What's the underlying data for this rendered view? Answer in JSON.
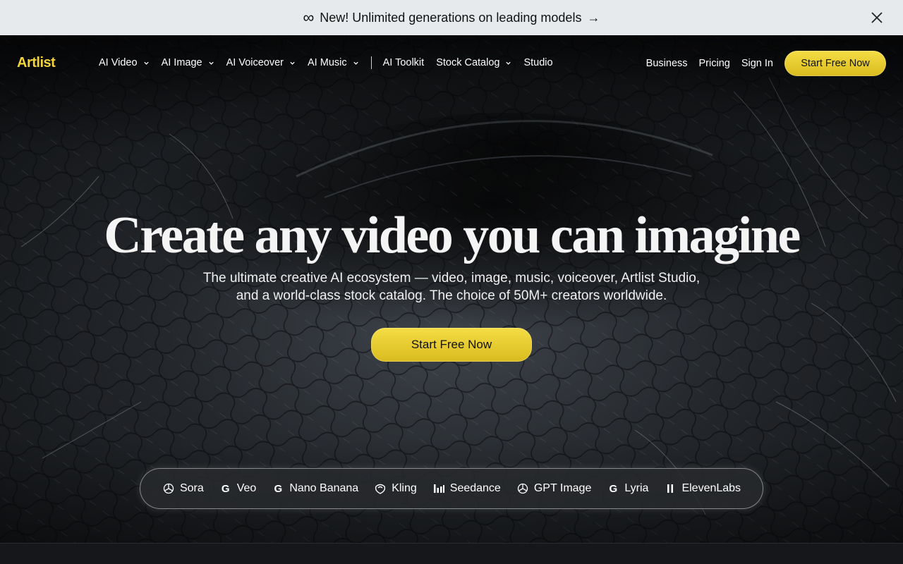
{
  "announcement": {
    "icon": "infinity-icon",
    "text": "New! Unlimited generations on leading models",
    "arrow": "→"
  },
  "nav": {
    "logo": "Artlist",
    "menu": [
      {
        "label": "AI Video",
        "dropdown": true
      },
      {
        "label": "AI Image",
        "dropdown": true
      },
      {
        "label": "AI Voiceover",
        "dropdown": true
      },
      {
        "label": "AI Music",
        "dropdown": true
      },
      {
        "label": "AI Toolkit",
        "dropdown": false
      },
      {
        "label": "Stock Catalog",
        "dropdown": true
      },
      {
        "label": "Studio",
        "dropdown": false
      }
    ],
    "right": {
      "business": "Business",
      "pricing": "Pricing",
      "signin": "Sign In",
      "cta": "Start Free Now"
    }
  },
  "hero": {
    "headline": "Create any video you can imagine",
    "sub_line1": "The ultimate creative AI ecosystem — video, image, music, voiceover, Artlist Studio,",
    "sub_line2": "and a world-class stock catalog. The choice of 50M+ creators worldwide.",
    "cta": "Start Free Now"
  },
  "models": [
    {
      "label": "Sora",
      "icon": "openai-icon"
    },
    {
      "label": "Veo",
      "icon": "google-icon"
    },
    {
      "label": "Nano Banana",
      "icon": "google-icon"
    },
    {
      "label": "Kling",
      "icon": "kling-icon"
    },
    {
      "label": "Seedance",
      "icon": "bars-icon"
    },
    {
      "label": "GPT Image",
      "icon": "openai-icon"
    },
    {
      "label": "Lyria",
      "icon": "google-icon"
    },
    {
      "label": "ElevenLabs",
      "icon": "pause-icon"
    }
  ],
  "colors": {
    "accent": "#f2d43a",
    "announcement_bg": "#e6eaed"
  }
}
